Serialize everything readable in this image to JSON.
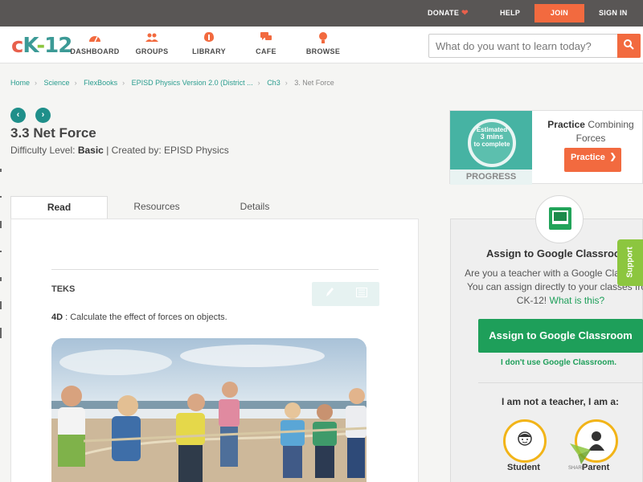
{
  "topbar": {
    "donate": "DONATE",
    "help": "HELP",
    "join": "JOIN",
    "signin": "SIGN IN"
  },
  "logo": {
    "c": "c",
    "k": "K",
    "dash": "-",
    "num": "12"
  },
  "nav": [
    {
      "label": "DASHBOARD",
      "icon": "dashboard-icon"
    },
    {
      "label": "GROUPS",
      "icon": "groups-icon"
    },
    {
      "label": "LIBRARY",
      "icon": "library-icon"
    },
    {
      "label": "CAFE",
      "icon": "cafe-icon"
    },
    {
      "label": "BROWSE",
      "icon": "browse-icon"
    }
  ],
  "search": {
    "placeholder": "What do you want to learn today?"
  },
  "breadcrumb": [
    "Home",
    "Science",
    "FlexBooks",
    "EPISD Physics Version 2.0 (District ...",
    "Ch3",
    "3. Net Force"
  ],
  "page": {
    "title": "3.3 Net Force",
    "difficulty_label": "Difficulty Level:",
    "difficulty_value": "Basic",
    "created_by": "| Created by: EPISD Physics"
  },
  "tabs": {
    "read": "Read",
    "resources": "Resources",
    "details": "Details"
  },
  "content": {
    "teks_heading": "TEKS",
    "teks_code": "4D",
    "teks_text": ":  Calculate the effect of forces on objects."
  },
  "practice": {
    "est_line1": "Estimated",
    "est_line2": "3 mins",
    "est_line3": "to complete",
    "progress": "PROGRESS",
    "title_bold": "Practice",
    "title_rest": "Combining Forces",
    "button": "Practice"
  },
  "assign": {
    "heading": "Assign to Google Classroom",
    "body": "Are you a teacher with a Google Classroom? You can assign directly to your classes from CK-12!",
    "what_link": "What is this?",
    "button": "Assign to Google Classroom",
    "no_gc": "I don't use Google Classroom.",
    "not_teacher": "I am not a teacher, I am a:",
    "student": "Student",
    "parent": "Parent"
  },
  "support": "Support",
  "share": "SHARE",
  "colors": {
    "accent": "#f26a3f",
    "teal": "#1f8f8a",
    "green": "#1e9f5a",
    "topbar": "#595655"
  }
}
